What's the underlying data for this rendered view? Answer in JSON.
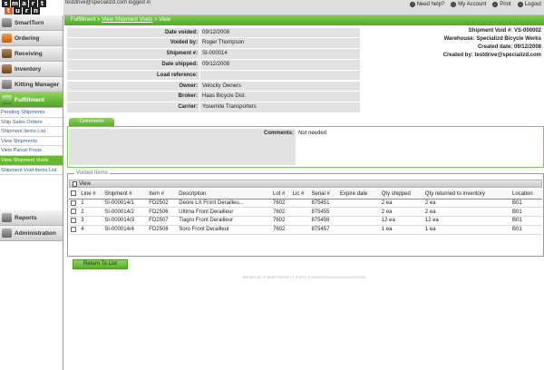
{
  "header": {
    "user_line": "testdrive@specializd.com logged in",
    "links": [
      {
        "label": "Need help?",
        "icon": "help-icon"
      },
      {
        "label": "My Account",
        "icon": "account-icon"
      },
      {
        "label": "Print",
        "icon": "print-icon"
      },
      {
        "label": "Logout",
        "icon": "logout-icon"
      }
    ]
  },
  "logo": {
    "row1": [
      "s",
      "m",
      "a",
      "r",
      "t"
    ],
    "row2": [
      "t",
      "u",
      "r",
      "n"
    ]
  },
  "sidebar": {
    "sections": [
      {
        "label": "SmartTurn",
        "icon": "smartturn-icon"
      },
      {
        "label": "Ordering",
        "icon": "ordering-icon"
      },
      {
        "label": "Receiving",
        "icon": "receiving-icon"
      },
      {
        "label": "Inventory",
        "icon": "inventory-icon"
      },
      {
        "label": "Kitting Manager",
        "icon": "kitting-icon"
      },
      {
        "label": "Fulfillment",
        "icon": "fulfillment-icon"
      }
    ],
    "fulfillment_items": [
      "Pending Shipments",
      "Ship Sales Orders",
      "Shipment Items List",
      "View Shipments",
      "View Parcel Posts",
      "View Shipment Voids",
      "Shipment Void Items List"
    ],
    "bottom_sections": [
      {
        "label": "Reports",
        "icon": "reports-icon"
      },
      {
        "label": "Administration",
        "icon": "administration-icon"
      }
    ]
  },
  "breadcrumb": {
    "part1": "Fulfillment",
    "sep": " > ",
    "part2": "View Shipment Voids",
    "part3": "View"
  },
  "form": [
    {
      "label": "Date voided:",
      "value": "09/12/2008"
    },
    {
      "label": "Voided by:",
      "value": "Roger Thompson"
    },
    {
      "label": "Shipment #:",
      "value": "SI-000014"
    },
    {
      "label": "Date shipped:",
      "value": "09/12/2008"
    },
    {
      "label": "Load reference:",
      "value": ""
    },
    {
      "label": "Owner:",
      "value": "Velocity Owners"
    },
    {
      "label": "Broker:",
      "value": "Haas Bicycle Dist."
    },
    {
      "label": "Carrier:",
      "value": "Yosemite Transporters"
    }
  ],
  "info": {
    "void_no": "Shipment Void #: VS-000002",
    "warehouse": "Warehouse: Specializd Bicycle Werks",
    "created_date": "Created date: 09/12/2008",
    "created_by": "Created by: testdrive@specializd.com"
  },
  "comments": {
    "tab": "Comments",
    "label": "Comments:",
    "value": "Not needed"
  },
  "voided_items": {
    "legend": "Voided Items",
    "view_label": "View",
    "columns": [
      "Line #",
      "Shipment #",
      "Item #",
      "Description",
      "Lot #",
      "Lic #",
      "Serial #",
      "Expire date",
      "Qty shipped",
      "Qty returned to inventory",
      "Location"
    ],
    "rows": [
      [
        "1",
        "SI-000014/1",
        "FD2502",
        "Deore LX Front Derailleu...",
        "7602",
        "",
        "875451",
        "",
        "2 ea",
        "2 ea",
        "B01"
      ],
      [
        "2",
        "SI-000014/2",
        "FD2506",
        "Ultima Front Derailleur",
        "7602",
        "",
        "875455",
        "",
        "2 ea",
        "2 ea",
        "B01"
      ],
      [
        "3",
        "SI-000014/3",
        "FD2507",
        "Tiagro Front Derailleur",
        "7602",
        "",
        "875456",
        "",
        "12 ea",
        "12 ea",
        "B01"
      ],
      [
        "4",
        "SI-000014/4",
        "FD2508",
        "Soro Front Derailleur",
        "7602",
        "",
        "875457",
        "",
        "1 ea",
        "1 ea",
        "B01"
      ]
    ]
  },
  "return_button": "Return To List",
  "footer": "SmartTurn ® Build Version 1.4.2.51 (xxxxxxxxxxxxxxxxxxxxxxxxxxx)"
}
